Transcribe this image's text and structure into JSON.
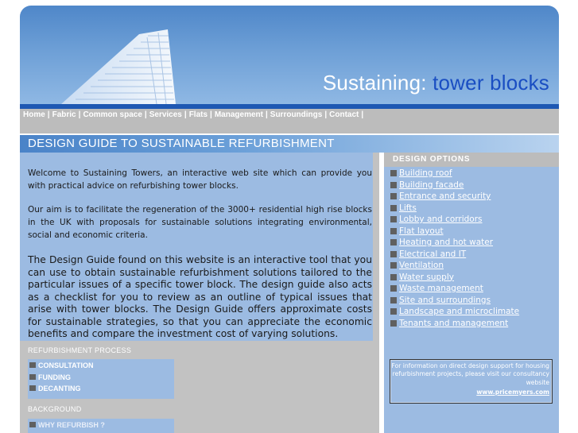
{
  "header": {
    "title_main": "Sustaining:",
    "title_accent": "tower blocks"
  },
  "nav": {
    "items": [
      "Home",
      "Fabric",
      "Common space",
      "Services",
      "Flats",
      "Management",
      "Surroundings",
      "Contact"
    ],
    "separator": "|"
  },
  "guide": {
    "title": "DESIGN GUIDE TO SUSTAINABLE REFURBISHMENT",
    "paragraphs": [
      "Welcome to Sustaining Towers, an interactive web site which can provide you with practical advice on refurbishing tower blocks.",
      "Our aim is to facilitate the regeneration of the 3000+ residential high rise blocks in the UK with proposals for sustainable solutions integrating environmental, social and economic criteria.",
      "The Design Guide found on this website is an interactive tool that you can use to obtain sustainable refurbishment solutions tailored to the particular issues of a specific tower block. The design guide also acts as a checklist for you to review as an outline of typical issues that arise with tower blocks. The Design Guide offers approximate costs for sustainable strategies, so that you can appreciate the economic benefits and compare the investment cost of varying solutions."
    ]
  },
  "refurbishment": {
    "heading": "REFURBISHMENT PROCESS",
    "items": [
      "CONSULTATION",
      "FUNDING",
      "DECANTING"
    ]
  },
  "background": {
    "heading": "BACKGROUND",
    "items": [
      "WHY REFURBISH ?"
    ]
  },
  "design_options": {
    "heading": "DESIGN OPTIONS",
    "items": [
      "Building roof",
      "Building facade",
      "Entrance and security",
      "Lifts",
      "Lobby and corridors",
      "Flat layout",
      "Heating and hot water",
      "Electrical and IT",
      "Ventilation",
      "Water supply",
      "Waste management",
      "Site and surroundings",
      "Landscape and microclimate",
      "Tenants and management"
    ]
  },
  "consultancy": {
    "text": "For information on direct design support for housing refurbishment projects, please visit our consultancy website",
    "link": "www.pricemyers.com"
  },
  "colors": {
    "accent": "#1a4ec2",
    "panel_blue": "#9cbbe2",
    "bar_grey": "#bcbcbc",
    "nav_rule": "#1e58b3"
  }
}
